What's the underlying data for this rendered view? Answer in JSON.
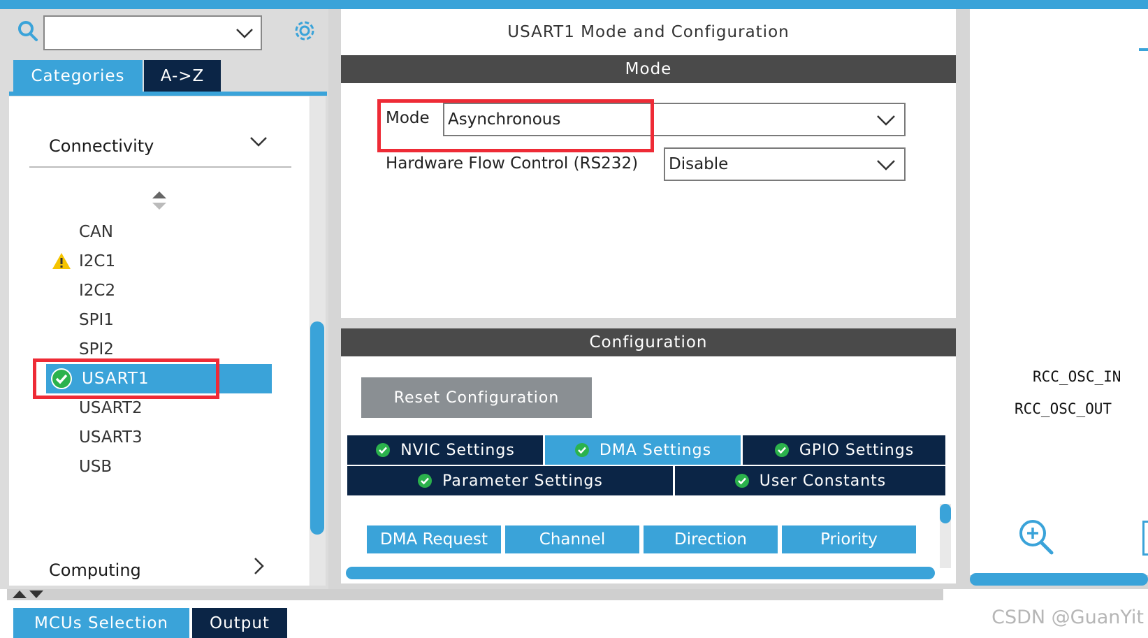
{
  "left": {
    "search_value": "",
    "tabs": {
      "categories": "Categories",
      "az": "A->Z"
    },
    "group_connectivity": "Connectivity",
    "items": [
      "CAN",
      "I2C1",
      "I2C2",
      "SPI1",
      "SPI2",
      "USART1",
      "USART2",
      "USART3",
      "USB"
    ],
    "selected_item": "USART1",
    "warning_item": "I2C1",
    "group_computing": "Computing"
  },
  "bottom_tabs": {
    "mcus": "MCUs Selection",
    "output": "Output"
  },
  "config": {
    "title": "USART1 Mode and Configuration",
    "mode_header": "Mode",
    "mode_label": "Mode",
    "mode_value": "Asynchronous",
    "hfc_label": "Hardware Flow Control (RS232)",
    "hfc_value": "Disable",
    "config_header": "Configuration",
    "reset_button": "Reset Configuration",
    "tabs_row1": [
      "NVIC Settings",
      "DMA Settings",
      "GPIO Settings"
    ],
    "tabs_row2": [
      "Parameter Settings",
      "User Constants"
    ],
    "active_tab": "DMA Settings",
    "dma_columns": [
      "DMA Request",
      "Channel",
      "Direction",
      "Priority"
    ]
  },
  "pinout": {
    "pins": [
      "RCC_OSC_IN",
      "RCC_OSC_OUT"
    ]
  },
  "watermark": "CSDN @GuanYit",
  "colors": {
    "accent": "#3aa3d9",
    "navy": "#0b2546",
    "highlight": "#ee2b36",
    "header": "#4a4a4a",
    "ok_green": "#2bb24c",
    "warning": "#f5c400"
  }
}
